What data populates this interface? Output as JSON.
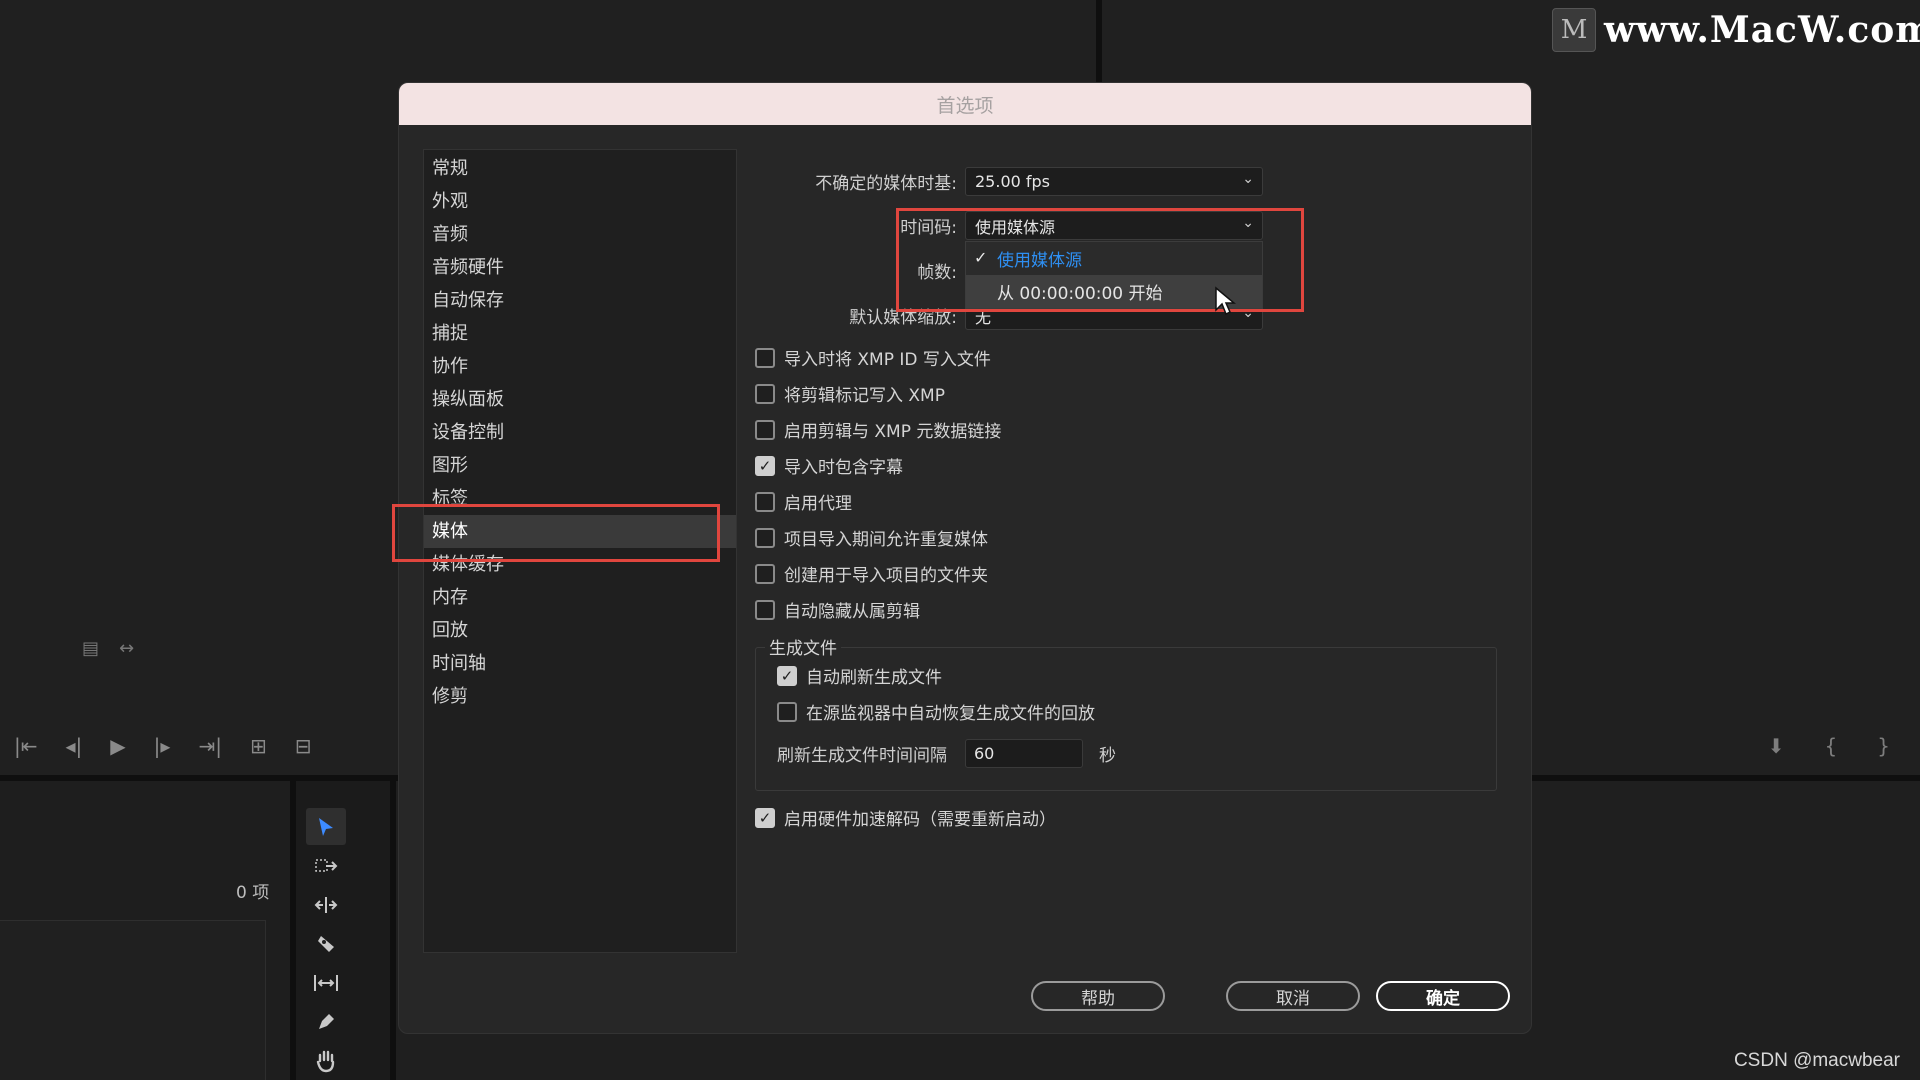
{
  "watermark": {
    "logo_glyph": "M",
    "text": "www.MacW.com"
  },
  "credit": "CSDN @macwbear",
  "background": {
    "item_count": "0 项",
    "transport_glyphs": [
      "|⇤",
      "◂|",
      "▶",
      "|▸",
      "⇥|",
      "⊞",
      "⊟"
    ],
    "transport_right_glyphs": [
      "⬇",
      "{",
      "}"
    ],
    "mini_icons": [
      "▤",
      "↔"
    ]
  },
  "dialog": {
    "title": "首选项",
    "sidebar": [
      "常规",
      "外观",
      "音频",
      "音频硬件",
      "自动保存",
      "捕捉",
      "协作",
      "操纵面板",
      "设备控制",
      "图形",
      "标签",
      "媒体",
      "媒体缓存",
      "内存",
      "回放",
      "时间轴",
      "修剪"
    ],
    "selected_item": "媒体",
    "fields": {
      "timebase_label": "不确定的媒体时基:",
      "timebase_value": "25.00 fps",
      "timecode_label": "时间码:",
      "timecode_value": "使用媒体源",
      "frames_label": "帧数:",
      "scale_label": "默认媒体缩放:",
      "scale_value": "无"
    },
    "dropdown": {
      "options": [
        "使用媒体源",
        "从 00:00:00:00 开始"
      ],
      "checked": "使用媒体源",
      "hovered": "从 00:00:00:00 开始"
    },
    "checkboxes": [
      {
        "label": "导入时将 XMP ID 写入文件",
        "checked": false
      },
      {
        "label": "将剪辑标记写入 XMP",
        "checked": false
      },
      {
        "label": "启用剪辑与 XMP 元数据链接",
        "checked": false
      },
      {
        "label": "导入时包含字幕",
        "checked": true
      },
      {
        "label": "启用代理",
        "checked": false
      },
      {
        "label": "项目导入期间允许重复媒体",
        "checked": false
      },
      {
        "label": "创建用于导入项目的文件夹",
        "checked": false
      },
      {
        "label": "自动隐藏从属剪辑",
        "checked": false
      }
    ],
    "render_group": {
      "title": "生成文件",
      "auto_refresh": {
        "label": "自动刷新生成文件",
        "checked": true
      },
      "auto_restore": {
        "label": "在源监视器中自动恢复生成文件的回放",
        "checked": false
      },
      "interval_label": "刷新生成文件时间间隔",
      "interval_value": "60",
      "interval_unit": "秒"
    },
    "hw_decode": {
      "label": "启用硬件加速解码（需要重新启动）",
      "checked": true
    },
    "buttons": {
      "help": "帮助",
      "cancel": "取消",
      "ok": "确定"
    }
  },
  "colors": {
    "accent": "#2e8ff2",
    "highlight": "#e0463e",
    "title_bar": "#f3e3e3"
  }
}
